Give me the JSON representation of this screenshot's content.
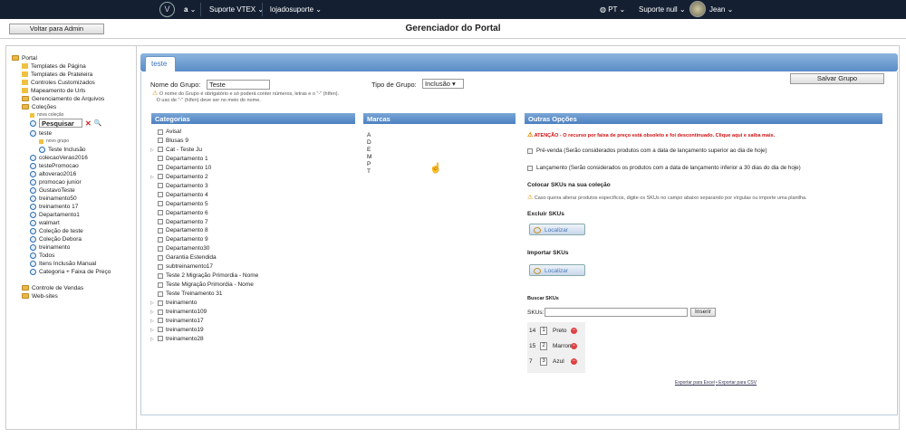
{
  "topbar": {
    "logo": "V",
    "account": "a",
    "suporte": "Suporte VTEX",
    "store": "lojadosuporte",
    "lang": "PT",
    "support_null": "Suporte null",
    "user": "Jean"
  },
  "header": {
    "back": "Voltar para Admin",
    "title": "Gerenciador do Portal"
  },
  "sidebar": {
    "root": "Portal",
    "items": [
      "Templates de Página",
      "Templates de Prateleira",
      "Controles Customizados",
      "Mapeamento de Urls",
      "Gerenciamento de Arquivos",
      "Coleções"
    ],
    "nova_colecao": "nova coleção",
    "search_value": "Pesquisar",
    "teste": "teste",
    "novo_grupo": "novo grupo",
    "teste_inclusao": "Teste Inclusão",
    "collections": [
      "colecaoVerao2016",
      "testePromocao",
      "altoverao2016",
      "promocao junior",
      "GustavoTeste",
      "treinamento50",
      "treinamento 17",
      "Departamento1",
      "walmart",
      "Coleção de teste",
      "Coleção Debora",
      "treinamento",
      "Todos",
      "Itens Inclusão Manual",
      "Categoria + Faixa de Preço"
    ],
    "footer_items": [
      "Controle de Vendas",
      "Web-sites"
    ]
  },
  "tab": "teste",
  "form": {
    "group_name_label": "Nome do Grupo:",
    "group_name_value": "Teste",
    "group_type_label": "Tipo de Grupo:",
    "group_type_value": "Inclusão",
    "save": "Salvar Grupo",
    "warn1": "O nome do Grupo é obrigatório e só poderá conter números, letras e o \"-\" (hífen).",
    "warn2": "O uso de \"-\" (hífen) deve ser no meio do nome."
  },
  "categorias": {
    "title": "Categorias",
    "items": [
      "Avisa!",
      "Blusas 9",
      "Cat - Teste Ju",
      "Departamento 1",
      "Departamento 10",
      "Departamento 2",
      "Departamento 3",
      "Departamento 4",
      "Departamento 5",
      "Departamento 6",
      "Departamento 7",
      "Departamento 8",
      "Departamento 9",
      "Departamento30",
      "Garantia Estendida",
      "subtreinamento17",
      "Teste 2 Migração Primordia - Nome",
      "Teste Migração Primordia - Nome",
      "Teste Treinamento 31",
      "treinamento",
      "treinamento109",
      "treinamento17",
      "treinamento19",
      "treinamento28"
    ]
  },
  "marcas": {
    "title": "Marcas",
    "letters": [
      "A",
      "D",
      "E",
      "M",
      "P",
      "T"
    ]
  },
  "outras": {
    "title": "Outras Opções",
    "alert": "ATENÇÃO - O recurso por faixa de preço está obsoleto e foi descontinuado. Clique aqui e saiba mais.",
    "prevenda": "Pré-venda (Serão considerados produtos com a data de lançamento superior ao dia de hoje)",
    "lancamento": "Lançamento (Serão considerados os produtos com a data de lançamento inferior a 30 dias do dia de hoje)",
    "colocar": "Colocar SKUs na sua coleção",
    "colocar_hint": "Caso queira alterar produtos específicos, digite os SKUs no campo abaixo separando por vírgulas ou importe uma planilha.",
    "excluir": "Excluir SKUs",
    "localizar": "Localizar",
    "importar": "Importar SKUs",
    "buscar": "Buscar SKUs",
    "skus_label": "SKUs:",
    "inserir": "Inserir",
    "rows": [
      {
        "n": "14",
        "v": "1",
        "c": "Preto"
      },
      {
        "n": "15",
        "v": "2",
        "c": "Marrom"
      },
      {
        "n": "7",
        "v": "3",
        "c": "Azul"
      }
    ],
    "exp_excel": "Exportar para Excel",
    "exp_csv": "Exportar para CSV"
  }
}
